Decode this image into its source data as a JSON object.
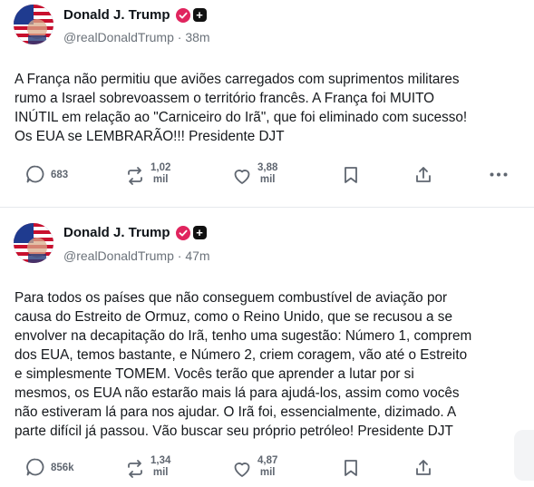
{
  "posts": [
    {
      "author_name": "Donald J. Trump",
      "handle": "@realDonaldTrump",
      "time": "38m",
      "text": "A França não permitiu que aviões carregados com suprimentos militares\nrumo a Israel sobrevoassem o território francês. A França foi MUITO\nINÚTIL em relação ao \"Carniceiro do Irã\", que foi eliminado com sucesso!\nOs EUA se LEMBRARÃO!!! Presidente DJT",
      "replies": "683",
      "reposts_line1": "1,02",
      "reposts_line2": "mil",
      "likes_line1": "3,88",
      "likes_line2": "mil"
    },
    {
      "author_name": "Donald J. Trump",
      "handle": "@realDonaldTrump",
      "time": "47m",
      "text": "Para todos os países que não conseguem combustível de aviação por\ncausa do Estreito de Ormuz, como o Reino Unido, que se recusou a se\nenvolver na decapitação do Irã, tenho uma sugestão: Número 1, comprem\ndos EUA, temos bastante, e Número 2, criem coragem, vão até o Estreito\ne simplesmente TOMEM. Vocês terão que aprender a lutar por si\nmesmos, os EUA não estarão mais lá para ajudá-los, assim como vocês\nnão estiveram lá para nos ajudar. O Irã foi, essencialmente, dizimado. A\nparte difícil já passou. Vão buscar seu próprio petróleo! Presidente DJT",
      "replies": "856k",
      "reposts_line1": "1,34",
      "reposts_line2": "mil",
      "likes_line1": "4,87",
      "likes_line2": "mil"
    }
  ],
  "separator": "·",
  "badge_plus": "+",
  "colors": {
    "verified": "#e0245e",
    "muted": "#5f6670",
    "divider": "#e6e9ec"
  }
}
